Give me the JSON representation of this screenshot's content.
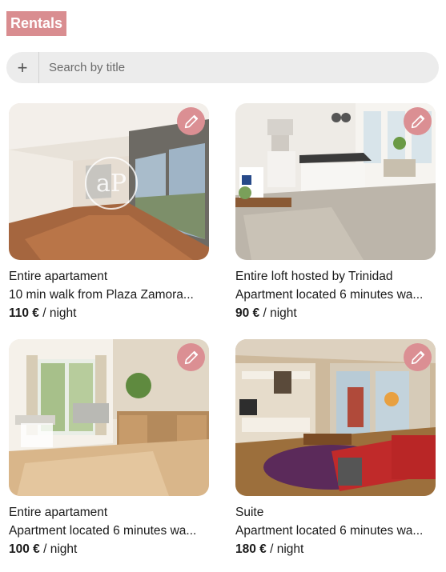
{
  "app": {
    "title": "Rentals"
  },
  "search": {
    "add_icon": "plus-icon",
    "placeholder": "Search by title",
    "value": ""
  },
  "listings": [
    {
      "type": "Entire apartament",
      "description": "10 min walk from Plaza Zamora...",
      "price": "110 €",
      "price_suffix": " / night",
      "edit_icon": "pencil-icon",
      "watermark": "aP"
    },
    {
      "type": "Entire loft hosted by Trinidad",
      "description": "Apartment located 6 minutes wa...",
      "price": "90 €",
      "price_suffix": " / night",
      "edit_icon": "pencil-icon"
    },
    {
      "type": "Entire apartament",
      "description": "Apartment located 6 minutes wa...",
      "price": "100 €",
      "price_suffix": " / night",
      "edit_icon": "pencil-icon"
    },
    {
      "type": "Suite",
      "description": "Apartment located 6 minutes wa...",
      "price": "180 €",
      "price_suffix": " / night",
      "edit_icon": "pencil-icon"
    }
  ],
  "colors": {
    "accent": "#d98d90",
    "search_bg": "#ececec"
  }
}
